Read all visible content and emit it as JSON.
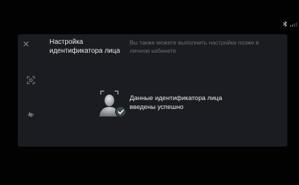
{
  "header": {
    "title": "Настройка идентификатора лица",
    "hint": "Вы также можете выполнить настройки позже в личном кабинете"
  },
  "result": {
    "message": "Данные идентификатора лица введены успешно"
  },
  "icons": {
    "close": "close-icon",
    "face_scan": "face-scan-icon",
    "voice": "voice-icon",
    "success": "face-success-icon",
    "bluetooth": "bluetooth-icon",
    "signal": "signal-icon"
  },
  "colors": {
    "background": "#020203",
    "panel": "#1b1c21",
    "text_primary": "#ececec",
    "text_secondary": "#6d6f76",
    "success_badge": "#3b4a42"
  }
}
